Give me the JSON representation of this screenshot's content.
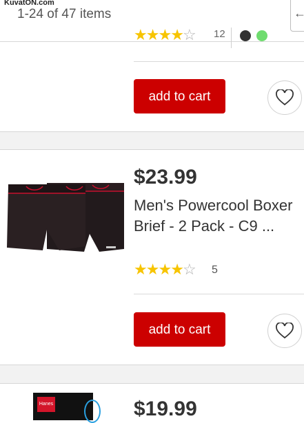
{
  "watermark": "KuvatON.com",
  "header": {
    "item_count": "1-24 of 47 items"
  },
  "products": [
    {
      "rating_count": "12",
      "rating": 4,
      "add_to_cart": "add to cart",
      "swatch_colors": [
        "#333333",
        "#6fdc6f"
      ]
    },
    {
      "price": "$23.99",
      "title": "Men's Powercool Boxer Brief - 2 Pack - C9 ...",
      "rating": 4,
      "rating_count": "5",
      "add_to_cart": "add to cart"
    },
    {
      "price": "$19.99",
      "image_label": "Hanes"
    }
  ],
  "icons": {
    "favorite": "heart-outline-icon",
    "star": "star-icon"
  },
  "colors": {
    "accent": "#cc0000",
    "star": "#f7c400"
  }
}
